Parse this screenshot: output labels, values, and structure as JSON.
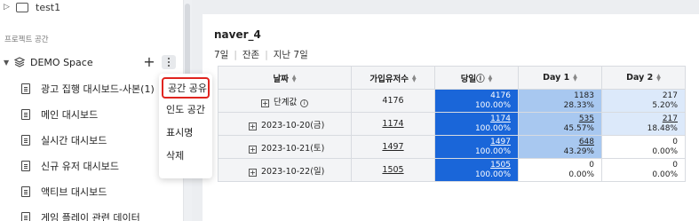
{
  "sidebar": {
    "folder": {
      "label": "test1"
    },
    "section_title": "프로젝트 공간",
    "space": {
      "label": "DEMO Space",
      "add_symbol": "+"
    },
    "items": [
      {
        "label": "광고 집행 대시보드-사본(1)"
      },
      {
        "label": "메인 대시보드"
      },
      {
        "label": "실시간 대시보드"
      },
      {
        "label": "신규 유저 대시보드"
      },
      {
        "label": "액티브 대시보드"
      },
      {
        "label": "게임 플레이 관련 데이터"
      }
    ]
  },
  "context_menu": {
    "items": [
      {
        "label": "공간 공유",
        "highlighted": true
      },
      {
        "label": "인도 공간"
      },
      {
        "label": "표시명"
      },
      {
        "label": "삭제"
      }
    ],
    "highlight_color": "#e0241f"
  },
  "report": {
    "title": "naver_4",
    "filters": [
      "7일",
      "잔존",
      "지난 7일"
    ],
    "columns": [
      "날짜",
      "가입유저수",
      "당일ⓘ",
      "Day 1",
      "Day 2"
    ],
    "summary_row": {
      "label": "단계값",
      "users": "4176",
      "d0": {
        "count": "4176",
        "pct": "100.00%"
      },
      "d1": {
        "count": "1183",
        "pct": "28.33%"
      },
      "d2": {
        "count": "217",
        "pct": "5.20%"
      }
    },
    "rows": [
      {
        "date": "2023-10-20(금)",
        "users": "1174",
        "d0": {
          "count": "1174",
          "pct": "100.00%"
        },
        "d1": {
          "count": "535",
          "pct": "45.57%"
        },
        "d2": {
          "count": "217",
          "pct": "18.48%"
        }
      },
      {
        "date": "2023-10-21(토)",
        "users": "1497",
        "d0": {
          "count": "1497",
          "pct": "100.00%"
        },
        "d1": {
          "count": "648",
          "pct": "43.29%"
        },
        "d2": {
          "count": "0",
          "pct": "0.00%"
        }
      },
      {
        "date": "2023-10-22(일)",
        "users": "1505",
        "d0": {
          "count": "1505",
          "pct": "100.00%"
        },
        "d1": {
          "count": "0",
          "pct": "0.00%"
        },
        "d2": {
          "count": "0",
          "pct": "0.00%"
        }
      }
    ],
    "colors": {
      "day0_fill": "#1a66d9",
      "day1_strong": "#a8c8f0",
      "day1_light": "#dce9fa",
      "day2_light": "#dce9fa",
      "empty": "#ffffff"
    }
  }
}
